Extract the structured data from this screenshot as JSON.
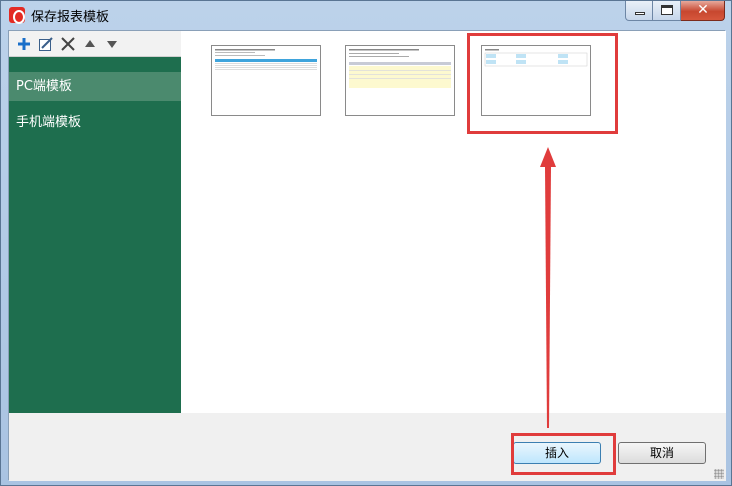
{
  "window": {
    "title": "保存报表模板"
  },
  "toolbar": {
    "icons": [
      "add-icon",
      "edit-icon",
      "delete-icon",
      "move-up-icon",
      "move-down-icon"
    ]
  },
  "sidebar": {
    "items": [
      {
        "label": "PC端模板",
        "selected": true
      },
      {
        "label": "手机端模板",
        "selected": false
      }
    ]
  },
  "templates": [
    {
      "id": "t1"
    },
    {
      "id": "t2"
    },
    {
      "id": "t3",
      "selected": true
    }
  ],
  "footer": {
    "insert_label": "插入",
    "cancel_label": "取消"
  },
  "colors": {
    "sidebar": "#1e6e4e",
    "sidebar_selected": "#4b8a6e",
    "highlight": "#e03c3c"
  }
}
